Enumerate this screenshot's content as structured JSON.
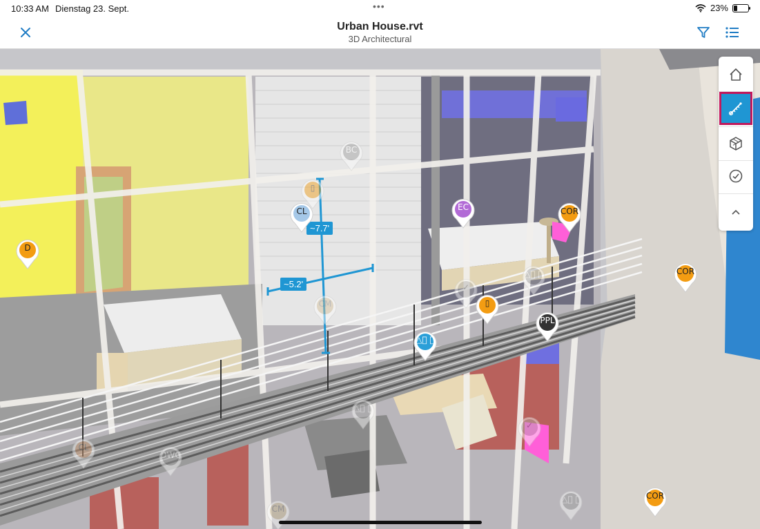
{
  "status_bar": {
    "time": "10:33 AM",
    "date": "Dienstag 23. Sept.",
    "multitask_dots": "•••",
    "battery": "23%",
    "battery_level": 0.23
  },
  "header": {
    "title": "Urban House.rvt",
    "subtitle": "3D Architectural",
    "icons": {
      "close": "close-icon",
      "filter": "filter-icon",
      "list": "list-icon"
    }
  },
  "measurement": {
    "vertical_label": "~7.7'",
    "horizontal_label": "~5.2'"
  },
  "pins": [
    {
      "label": "D",
      "color": "#f39c12",
      "text_color": "#222",
      "faded": false
    },
    {
      "label": "BC",
      "color": "#9e9e9e",
      "text_color": "#fff",
      "faded": true
    },
    {
      "label": "▯",
      "color": "#f39c12",
      "text_color": "#222",
      "faded": true
    },
    {
      "label": "CL",
      "color": "#a5c8e8",
      "text_color": "#222",
      "faded": false
    },
    {
      "label": "EC",
      "color": "#b26bd6",
      "text_color": "#fff",
      "faded": false
    },
    {
      "label": "COR",
      "color": "#f39c12",
      "text_color": "#222",
      "faded": false
    },
    {
      "label": "COR",
      "color": "#f39c12",
      "text_color": "#222",
      "faded": false
    },
    {
      "label": "△⃝ ⃝",
      "color": "#9e9e9e",
      "text_color": "#fff",
      "faded": true
    },
    {
      "label": "CM",
      "color": "#d7c29a",
      "text_color": "#888",
      "faded": true
    },
    {
      "label": "✓",
      "color": "#b0b0b0",
      "text_color": "#444",
      "faded": true
    },
    {
      "label": "▯",
      "color": "#f39c12",
      "text_color": "#222",
      "faded": false
    },
    {
      "label": "PPL",
      "color": "#333333",
      "text_color": "#fff",
      "faded": false
    },
    {
      "label": "△⃝ ⃝",
      "color": "#2a9fd8",
      "text_color": "#fff",
      "faded": false
    },
    {
      "label": "△⃝ ⃝",
      "color": "#9e9e9e",
      "text_color": "#fff",
      "faded": true
    },
    {
      "label": "CL",
      "color": "#d7a27a",
      "text_color": "#666",
      "faded": true
    },
    {
      "label": "DWC",
      "color": "#9e9e9e",
      "text_color": "#fff",
      "faded": true
    },
    {
      "label": "✓",
      "color": "#b0b0b0",
      "text_color": "#444",
      "faded": true
    },
    {
      "label": "CM",
      "color": "#c9b98f",
      "text_color": "#666",
      "faded": true
    },
    {
      "label": "△⃝ ⃝",
      "color": "#9e9e9e",
      "text_color": "#fff",
      "faded": true
    },
    {
      "label": "COR",
      "color": "#f39c12",
      "text_color": "#222",
      "faded": false
    }
  ],
  "toolbar": {
    "items": [
      {
        "icon": "home-icon",
        "active": false
      },
      {
        "icon": "measure-icon",
        "active": true
      },
      {
        "icon": "model-cube-icon",
        "active": false
      },
      {
        "icon": "checkmark-icon",
        "active": false
      },
      {
        "icon": "chevron-up-icon",
        "active": false
      }
    ]
  },
  "colors": {
    "accent": "#1f96d3",
    "highlight": "#c2185b"
  }
}
